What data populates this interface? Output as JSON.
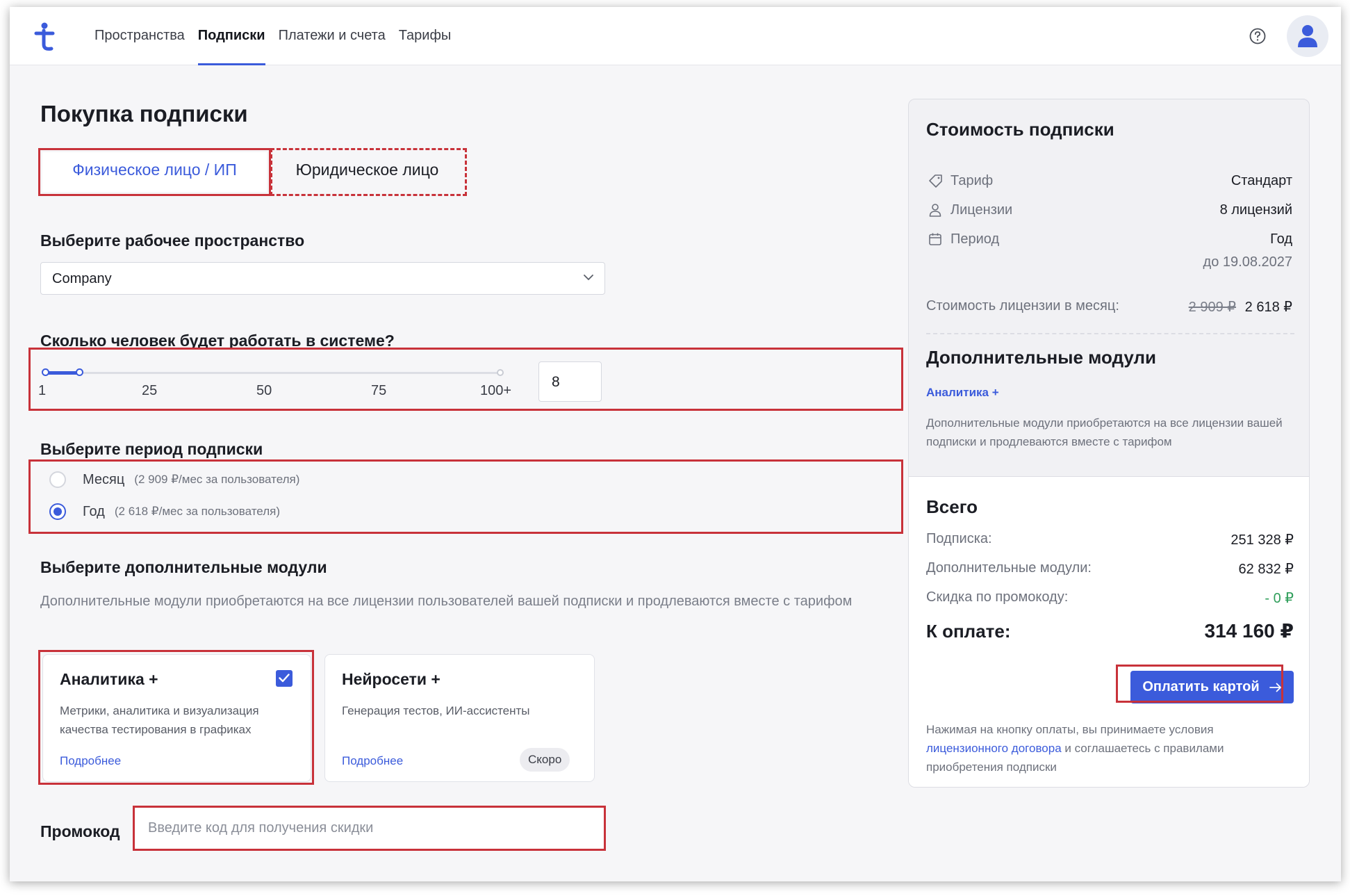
{
  "nav": {
    "items": [
      "Пространства",
      "Подписки",
      "Платежи и счета",
      "Тарифы"
    ],
    "active": "Подписки"
  },
  "icons": {
    "logo": "brand-t-logo-icon",
    "help": "question-circle-icon",
    "avatar": "user-avatar-icon",
    "chevron": "chevron-down-icon",
    "tag": "tag-icon",
    "user": "user-icon",
    "calendar": "calendar-icon",
    "check": "checkbox-checked-icon",
    "arrow": "arrow-right-icon"
  },
  "colors": {
    "accent": "#3b5bdb",
    "highlight": "#c8323a",
    "discount": "#2f9e5a"
  },
  "page": {
    "title": "Покупка подписки"
  },
  "payer": {
    "options": [
      "Физическое лицо / ИП",
      "Юридическое лицо"
    ],
    "selected": "Физическое лицо / ИП"
  },
  "workspace": {
    "label": "Выберите рабочее пространство",
    "value": "Company"
  },
  "users": {
    "label": "Сколько человек будет работать в системе?",
    "ticks": [
      "1",
      "25",
      "50",
      "75",
      "100+"
    ],
    "value": "8",
    "slider_value": 8,
    "slider_min": 1,
    "slider_max": 100
  },
  "period": {
    "label": "Выберите период подписки",
    "options": [
      {
        "label": "Месяц",
        "hint": "(2 909 ₽/мес за пользователя)",
        "checked": false
      },
      {
        "label": "Год",
        "hint": "(2 618 ₽/мес за пользователя)",
        "checked": true
      }
    ]
  },
  "modules": {
    "label": "Выберите дополнительные модули",
    "description": "Дополнительные модули приобретаются на все лицензии пользователей вашей подписки и продлеваются вместе с тарифом",
    "cards": [
      {
        "title": "Аналитика +",
        "description": "Метрики, аналитика и визуализация качества тестирования в графиках",
        "link": "Подробнее",
        "checked": true
      },
      {
        "title": "Нейросети +",
        "description": "Генерация тестов, ИИ-ассистенты",
        "link": "Подробнее",
        "badge": "Скоро"
      }
    ]
  },
  "promo": {
    "label": "Промокод",
    "placeholder": "Введите код для получения скидки"
  },
  "summary": {
    "title": "Стоимость подписки",
    "rows": [
      {
        "label": "Тариф",
        "value": "Стандарт"
      },
      {
        "label": "Лицензии",
        "value": "8 лицензий"
      },
      {
        "label": "Период",
        "value": "Год",
        "sub": "до 19.08.2027"
      }
    ],
    "license_price_label": "Стоимость лицензии в месяц:",
    "license_price_old": "2 909 ₽",
    "license_price_new": "2 618 ₽",
    "modules_title": "Дополнительные модули",
    "module_item": "Аналитика +",
    "modules_note": "Дополнительные модули приобретаются на все лицензии вашей подписки и продлеваются вместе с тарифом"
  },
  "totals": {
    "title": "Всего",
    "rows": [
      {
        "label": "Подписка:",
        "value": "251 328 ₽"
      },
      {
        "label": "Дополнительные модули:",
        "value": "62 832 ₽"
      },
      {
        "label": "Скидка по промокоду:",
        "value": "- 0 ₽"
      }
    ],
    "pay_label": "К оплате:",
    "pay_value": "314 160 ₽",
    "button": "Оплатить картой",
    "note_before": "Нажимая на кнопку оплаты, вы принимаете условия",
    "note_link": "лицензионного договора",
    "note_after": "и соглашаетесь с правилами приобретения подписки"
  }
}
